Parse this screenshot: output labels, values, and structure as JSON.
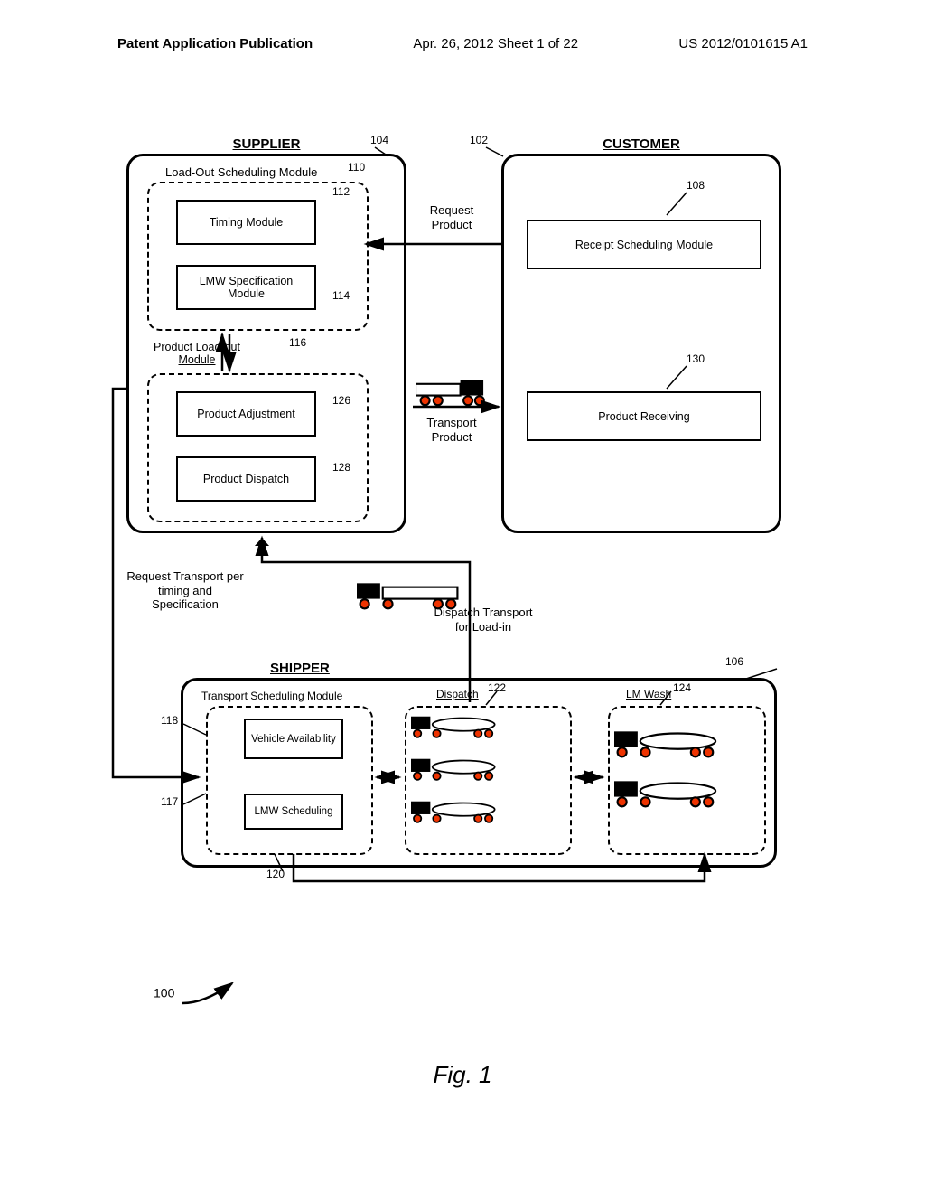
{
  "header": {
    "left": "Patent Application Publication",
    "mid": "Apr. 26, 2012  Sheet 1 of 22",
    "right": "US 2012/0101615 A1"
  },
  "entities": {
    "supplier": "SUPPLIER",
    "customer": "CUSTOMER",
    "shipper": "SHIPPER"
  },
  "supplier": {
    "loadout_sched": "Load-Out Scheduling Module",
    "timing": "Timing Module",
    "lmw_spec": "LMW Specification Module",
    "loadout_mod": "Product Load-out Module",
    "adjust": "Product Adjustment",
    "dispatch": "Product Dispatch"
  },
  "customer": {
    "receipt_sched": "Receipt Scheduling Module",
    "receiving": "Product Receiving"
  },
  "shipper": {
    "trans_sched": "Transport Scheduling Module",
    "veh_avail": "Vehicle Availability",
    "lmw_sched": "LMW Scheduling",
    "dispatch": "Dispatch",
    "lmwash": "LM Wash"
  },
  "labels": {
    "req_product": "Request Product",
    "transport_product": "Transport Product",
    "req_transport": "Request Transport per timing and Specification",
    "dispatch_loadin": "Dispatch Transport for Load-in"
  },
  "refs": {
    "r100": "100",
    "r102": "102",
    "r104": "104",
    "r106": "106",
    "r108": "108",
    "r110": "110",
    "r112": "112",
    "r114": "114",
    "r116": "116",
    "r117": "117",
    "r118": "118",
    "r120": "120",
    "r122": "122",
    "r124": "124",
    "r126": "126",
    "r128": "128",
    "r130": "130"
  },
  "caption": "Fig. 1",
  "chart_data": {
    "type": "block-diagram",
    "title": "Fig. 1",
    "figure_ref": 100,
    "entities": [
      {
        "name": "SUPPLIER",
        "ref": 104,
        "groups": [
          {
            "name": "Load-Out Scheduling Module",
            "ref": 110,
            "blocks": [
              {
                "name": "Timing Module",
                "ref": 112
              },
              {
                "name": "LMW Specification Module",
                "ref": 114
              }
            ]
          },
          {
            "name": "Product Load-out Module",
            "ref": 116,
            "blocks": [
              {
                "name": "Product Adjustment",
                "ref": 126
              },
              {
                "name": "Product Dispatch",
                "ref": 128
              }
            ]
          }
        ]
      },
      {
        "name": "CUSTOMER",
        "ref": 102,
        "blocks": [
          {
            "name": "Receipt Scheduling Module",
            "ref": 108
          },
          {
            "name": "Product Receiving",
            "ref": 130
          }
        ]
      },
      {
        "name": "SHIPPER",
        "ref": 106,
        "groups": [
          {
            "name": "Transport Scheduling Module",
            "ref": 117,
            "blocks": [
              {
                "name": "Vehicle Availability",
                "ref": 118
              },
              {
                "name": "LMW Scheduling",
                "ref": 120
              }
            ]
          },
          {
            "name": "Dispatch",
            "ref": 122,
            "vehicles": 3
          },
          {
            "name": "LM Wash",
            "ref": 124,
            "vehicles": 2
          }
        ]
      }
    ],
    "flows": [
      {
        "from": "CUSTOMER.Receipt Scheduling Module",
        "to": "SUPPLIER.Load-Out Scheduling Module",
        "label": "Request Product"
      },
      {
        "from": "SUPPLIER.Product Load-out Module",
        "to": "CUSTOMER.Product Receiving",
        "label": "Transport Product",
        "via": "truck"
      },
      {
        "from": "SUPPLIER",
        "to": "SHIPPER.Transport Scheduling Module",
        "label": "Request Transport per timing and Specification"
      },
      {
        "from": "SHIPPER.Dispatch",
        "to": "SUPPLIER.Product Load-out Module",
        "label": "Dispatch Transport for Load-in",
        "via": "truck"
      },
      {
        "from": "SUPPLIER.Load-Out Scheduling Module",
        "to": "SUPPLIER.Product Load-out Module",
        "dir": "both"
      },
      {
        "from": "SHIPPER.Transport Scheduling Module",
        "to": "SHIPPER.Dispatch",
        "dir": "both"
      },
      {
        "from": "SHIPPER.Dispatch",
        "to": "SHIPPER.LM Wash",
        "dir": "both"
      }
    ]
  }
}
